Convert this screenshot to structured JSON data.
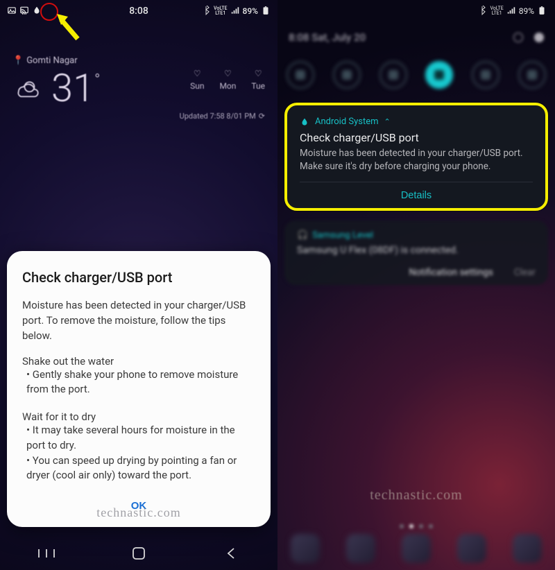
{
  "status": {
    "time": "8:08",
    "volte": "VoLTE",
    "net": "LTE1",
    "battery_pct": "89%"
  },
  "weather": {
    "location": "Gomti Nagar",
    "temp": "31",
    "days": [
      "Sun",
      "Mon",
      "Tue"
    ],
    "updated": "Updated 7:58 8/01 PM"
  },
  "dialog": {
    "title": "Check charger/USB port",
    "intro": "Moisture has been detected in your charger/USB port. To remove the moisture, follow the tips below.",
    "sect1_title": "Shake out the water",
    "sect1_b1": " • Gently shake your phone to remove moisture from the port.",
    "sect2_title": "Wait for it to dry",
    "sect2_b1": " • It may take several hours for moisture in the port to dry.",
    "sect2_b2": " • You can speed up drying by pointing a fan or dryer (cool air only) toward the port.",
    "ok": "OK"
  },
  "watermark": "technastic.com",
  "shade": {
    "datetime": "8:08  Sat, July 20"
  },
  "notif1": {
    "src": "Android System",
    "title": "Check charger/USB port",
    "body": "Moisture has been detected in your charger/USB port. Make sure it's dry before charging your phone.",
    "details": "Details"
  },
  "notif2": {
    "src": "Samsung Level",
    "line": "Samsung U Flex (08DF) is connected.",
    "settings": "Notification settings",
    "clear": "Clear"
  }
}
